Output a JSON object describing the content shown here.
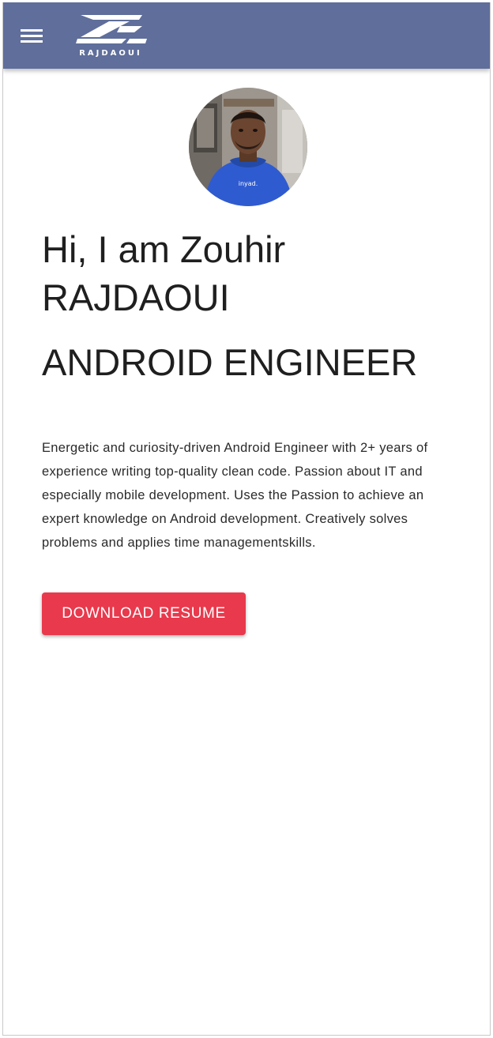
{
  "header": {
    "menu_icon": "hamburger-menu-icon",
    "logo_text": "RAJDAOUI",
    "background": "#5f6e9b"
  },
  "hero": {
    "name_line": "Hi, I am Zouhir RAJDAOUI",
    "role": "ANDROID ENGINEER",
    "bio": "Energetic and curiosity-driven Android Engineer with 2+ years of experience writing top-quality clean code. Passion about IT and especially mobile development. Uses the Passion to achieve an expert knowledge on Android development. Creatively solves problems and applies time managementskills.",
    "hoodie_text": "inyad.",
    "download_label": "DOWNLOAD RESUME",
    "accent": "#e9394c"
  }
}
